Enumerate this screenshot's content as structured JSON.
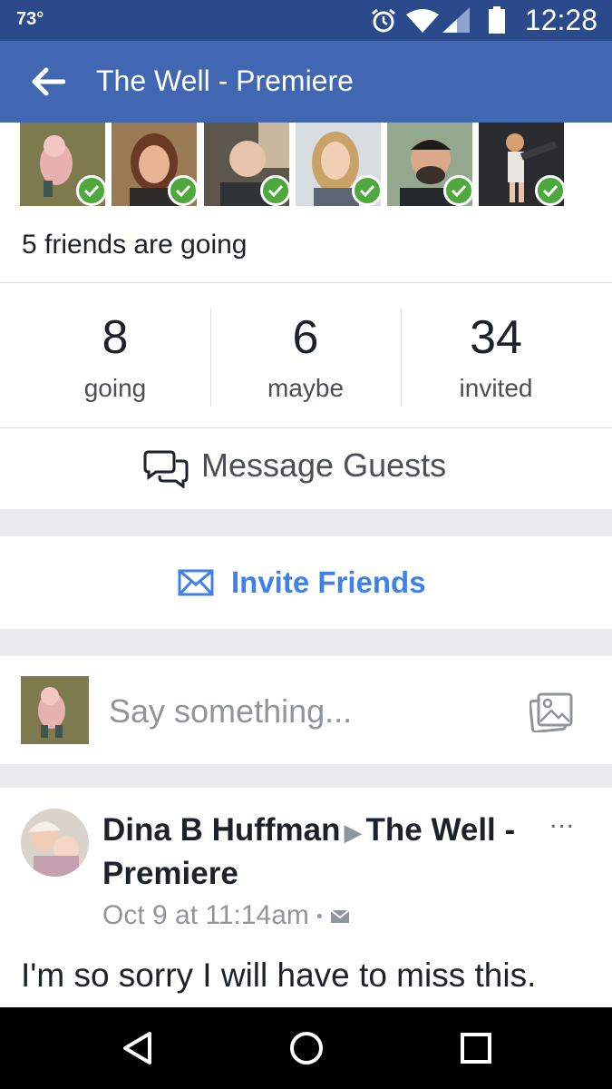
{
  "status_bar": {
    "temperature": "73°",
    "time": "12:28",
    "icons": [
      "alarm-icon",
      "wifi-icon",
      "signal-icon",
      "battery-icon"
    ]
  },
  "app_bar": {
    "back_icon": "arrow-left-icon",
    "title": "The Well - Premiere"
  },
  "friends": {
    "avatars": [
      {
        "name": "friend-avatar-1",
        "going": true
      },
      {
        "name": "friend-avatar-2",
        "going": true
      },
      {
        "name": "friend-avatar-3",
        "going": true
      },
      {
        "name": "friend-avatar-4",
        "going": true
      },
      {
        "name": "friend-avatar-5",
        "going": true
      },
      {
        "name": "friend-avatar-6",
        "going": true
      }
    ],
    "summary": "5 friends are going"
  },
  "stats": [
    {
      "count": "8",
      "label": "going"
    },
    {
      "count": "6",
      "label": "maybe"
    },
    {
      "count": "34",
      "label": "invited"
    }
  ],
  "message_guests": {
    "icon": "chat-bubbles-icon",
    "label": "Message Guests"
  },
  "invite_friends": {
    "icon": "envelope-icon",
    "label": "Invite Friends"
  },
  "composer": {
    "placeholder": "Say something...",
    "icon": "photo-icon"
  },
  "post": {
    "author": "Dina B Huffman",
    "target": "The Well - Premiere",
    "arrow": "▶",
    "timestamp": "Oct 9 at 11:14am",
    "separator": "•",
    "audience_icon": "envelope-icon",
    "more": "...",
    "body": "I'm so sorry I will have to miss this."
  },
  "nav_bar": {
    "icons": [
      "back-triangle-icon",
      "home-circle-icon",
      "recents-square-icon"
    ]
  },
  "colors": {
    "status_bar": "#2a4a8c",
    "app_bar": "#4267b2",
    "link_blue": "#4080e8",
    "check_green": "#4fa83d",
    "separator": "#e9ebee"
  }
}
